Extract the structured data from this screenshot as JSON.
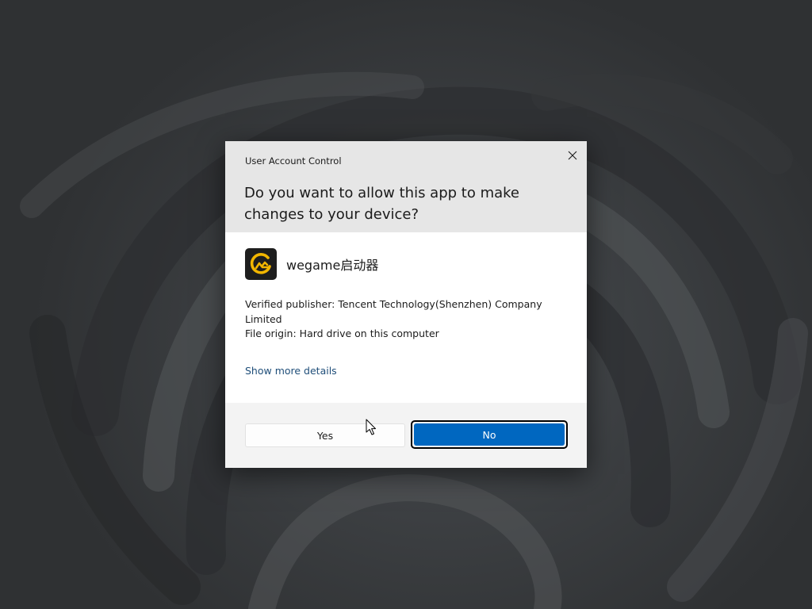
{
  "dialog": {
    "caption": "User Account Control",
    "question": "Do you want to allow this app to make changes to your device?",
    "app": {
      "name": "wegame启动器",
      "icon": "wegame-logo-icon",
      "icon_color": "#f2b600"
    },
    "publisher_line": "Verified publisher: Tencent Technology(Shenzhen) Company Limited",
    "origin_line": "File origin: Hard drive on this computer",
    "show_more_label": "Show more details",
    "yes_label": "Yes",
    "no_label": "No",
    "close_icon": "close-icon"
  },
  "colors": {
    "accent": "#0067c0",
    "link": "#1f4e79",
    "header_bg": "#e6e6e6",
    "body_bg": "#ffffff",
    "footer_bg": "#f3f3f3"
  },
  "desktop": {
    "wallpaper": "dark-bloom-wallpaper",
    "cursor": "arrow-cursor-icon"
  }
}
